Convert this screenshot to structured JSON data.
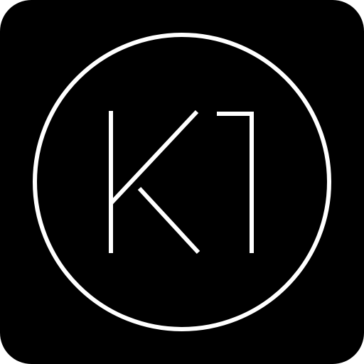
{
  "logo": {
    "text": "K1",
    "background_color": "#000000",
    "foreground_color": "#ffffff"
  }
}
